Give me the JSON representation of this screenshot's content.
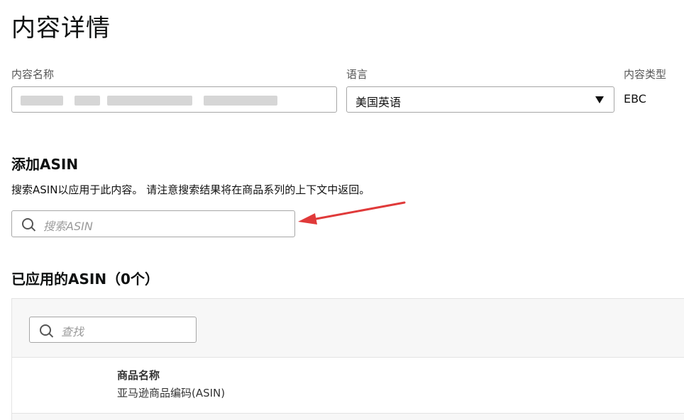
{
  "page": {
    "title": "内容详情"
  },
  "form": {
    "name_label": "内容名称",
    "language_label": "语言",
    "language_value": "美国英语",
    "type_label": "内容类型",
    "type_value": "EBC"
  },
  "add_asin": {
    "title": "添加ASIN",
    "help": "搜索ASIN以应用于此内容。 请注意搜索结果将在商品系列的上下文中返回。",
    "search_placeholder": "搜索ASIN"
  },
  "applied": {
    "title": "已应用的ASIN（0个）",
    "search_placeholder": "查找",
    "column_header": "商品名称",
    "column_subheader": "亚马逊商品编码(ASIN)"
  },
  "colors": {
    "arrow": "#e03a3a",
    "border": "#a6a6a6",
    "panel_bg": "#f7f7f7"
  },
  "icons": [
    "search-icon",
    "chevron-down-icon",
    "annotation-arrow"
  ]
}
